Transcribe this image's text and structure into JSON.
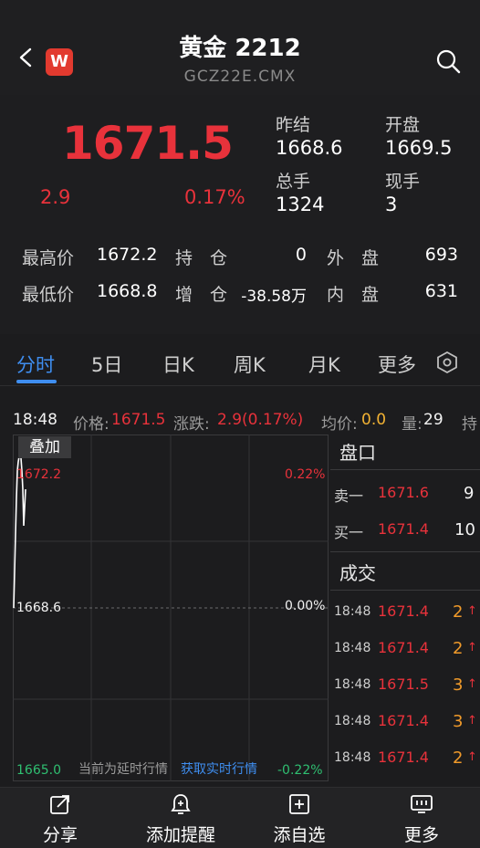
{
  "header": {
    "title": "黄金 2212",
    "subtitle": "GCZ22E.CMX",
    "logo_text": "W"
  },
  "quote": {
    "price": "1671.5",
    "change": "2.9",
    "change_pct": "0.17%",
    "prev_close_label": "昨结",
    "prev_close": "1668.6",
    "open_label": "开盘",
    "open": "1669.5",
    "total_vol_label": "总手",
    "total_vol": "1324",
    "cur_vol_label": "现手",
    "cur_vol": "3",
    "high_label": "最高价",
    "high": "1672.2",
    "low_label": "最低价",
    "low": "1668.8",
    "hold_label": "持　仓",
    "hold": "0",
    "inc_label": "增　仓",
    "inc": "-38.58万",
    "outer_label": "外　盘",
    "outer": "693",
    "inner_label": "内　盘",
    "inner": "631"
  },
  "tabs": [
    {
      "label": "分时",
      "active": true
    },
    {
      "label": "5日"
    },
    {
      "label": "日K"
    },
    {
      "label": "周K"
    },
    {
      "label": "月K"
    },
    {
      "label": "更多"
    }
  ],
  "info_line": {
    "time": "18:48",
    "price_label": "价格:",
    "price": "1671.5",
    "change_label": "涨跌:",
    "change": "2.9(0.17%)",
    "avg_label": "均价:",
    "avg": "0.0",
    "vol_label": "量:",
    "vol": "29",
    "extra": "持"
  },
  "chart": {
    "overlay_label": "叠加",
    "y_top": "1672.2",
    "y_mid": "1668.6",
    "y_bottom": "1665.0",
    "pct_top": "0.22%",
    "pct_mid": "0.00%",
    "pct_bottom": "-0.22%",
    "delay_note": "当前为延时行情",
    "realtime_link": "获取实时行情",
    "colors": {
      "up": "#e8323b",
      "down": "#2fbf71",
      "link": "#3f8ef0"
    }
  },
  "order_book": {
    "title": "盘口",
    "rows": [
      {
        "label": "卖一",
        "price": "1671.6",
        "qty": "9"
      },
      {
        "label": "买一",
        "price": "1671.4",
        "qty": "10"
      }
    ]
  },
  "trades": {
    "title": "成交",
    "rows": [
      {
        "time": "18:48",
        "price": "1671.4",
        "qty": "2"
      },
      {
        "time": "18:48",
        "price": "1671.4",
        "qty": "2"
      },
      {
        "time": "18:48",
        "price": "1671.5",
        "qty": "3"
      },
      {
        "time": "18:48",
        "price": "1671.4",
        "qty": "3"
      },
      {
        "time": "18:48",
        "price": "1671.4",
        "qty": "2"
      }
    ]
  },
  "bottom_bar": [
    {
      "label": "分享",
      "icon": "share-icon"
    },
    {
      "label": "添加提醒",
      "icon": "alarm-icon"
    },
    {
      "label": "添自选",
      "icon": "add-box-icon"
    },
    {
      "label": "更多",
      "icon": "more-icon"
    }
  ]
}
